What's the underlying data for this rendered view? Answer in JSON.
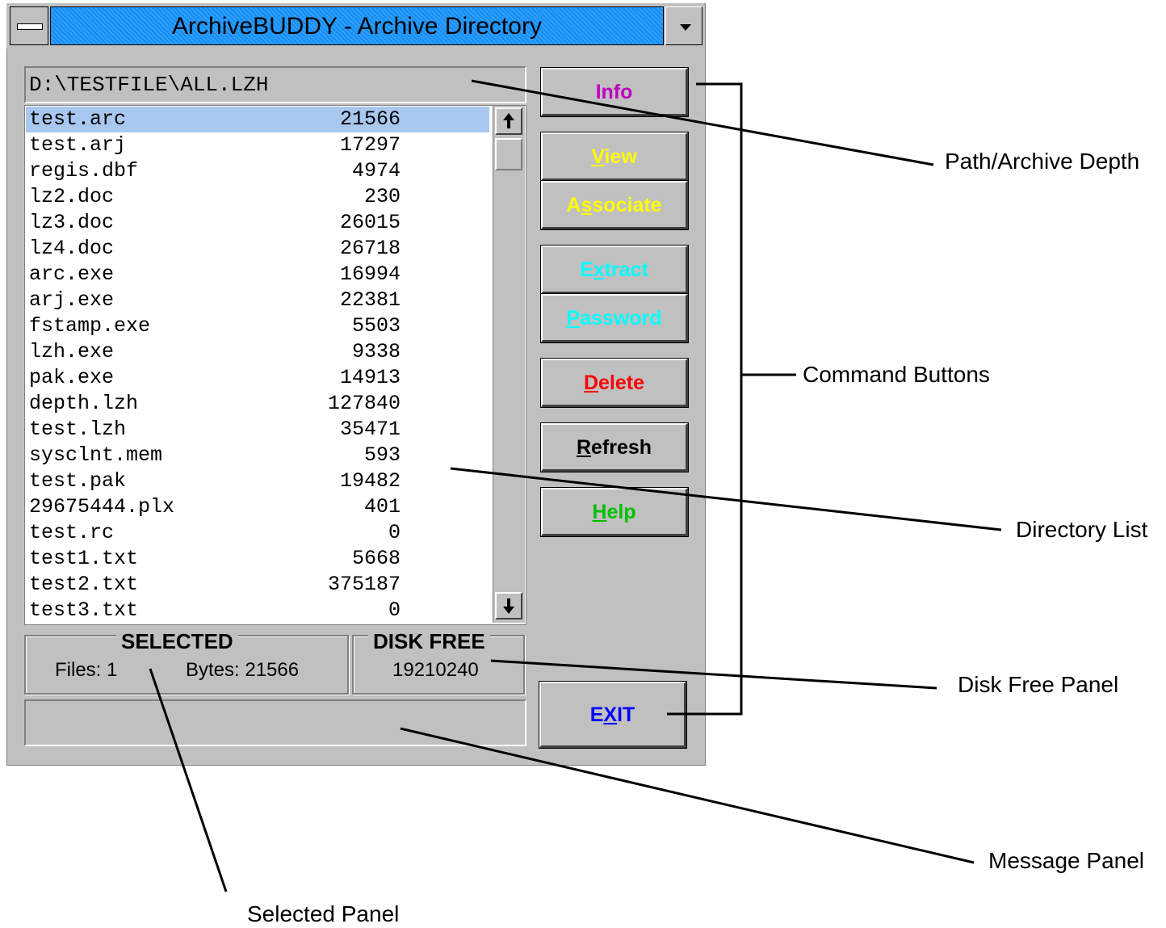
{
  "window": {
    "title": "ArchiveBUDDY - Archive Directory"
  },
  "path": "D:\\TESTFILE\\ALL.LZH",
  "files": [
    {
      "name": "test.arc",
      "size": "21566",
      "selected": true
    },
    {
      "name": "test.arj",
      "size": "17297"
    },
    {
      "name": "regis.dbf",
      "size": "4974"
    },
    {
      "name": "lz2.doc",
      "size": "230"
    },
    {
      "name": "lz3.doc",
      "size": "26015"
    },
    {
      "name": "lz4.doc",
      "size": "26718"
    },
    {
      "name": "arc.exe",
      "size": "16994"
    },
    {
      "name": "arj.exe",
      "size": "22381"
    },
    {
      "name": "fstamp.exe",
      "size": "5503"
    },
    {
      "name": "lzh.exe",
      "size": "9338"
    },
    {
      "name": "pak.exe",
      "size": "14913"
    },
    {
      "name": "depth.lzh",
      "size": "127840"
    },
    {
      "name": "test.lzh",
      "size": "35471"
    },
    {
      "name": "sysclnt.mem",
      "size": "593"
    },
    {
      "name": "test.pak",
      "size": "19482"
    },
    {
      "name": "29675444.plx",
      "size": "401"
    },
    {
      "name": "test.rc",
      "size": "0"
    },
    {
      "name": "test1.txt",
      "size": "5668"
    },
    {
      "name": "test2.txt",
      "size": "375187"
    },
    {
      "name": "test3.txt",
      "size": "0"
    }
  ],
  "buttons": {
    "info": {
      "label": "Info",
      "color": "#c000c0"
    },
    "view": {
      "pre": "",
      "ul": "V",
      "post": "iew",
      "color": "#ffff00"
    },
    "associate": {
      "pre": "A",
      "ul": "s",
      "post": "sociate",
      "color": "#ffff00"
    },
    "extract": {
      "pre": "E",
      "ul": "x",
      "post": "tract",
      "color": "#00ffff"
    },
    "password": {
      "pre": "",
      "ul": "P",
      "post": "assword",
      "color": "#00ffff"
    },
    "delete": {
      "pre": "",
      "ul": "D",
      "post": "elete",
      "color": "#ff0000"
    },
    "refresh": {
      "pre": "",
      "ul": "R",
      "post": "efresh",
      "color": "#000000"
    },
    "help": {
      "pre": "",
      "ul": "H",
      "post": "elp",
      "color": "#00c000"
    },
    "exit": {
      "pre": "E",
      "ul": "X",
      "post": "IT",
      "color": "#0000ff"
    }
  },
  "selected_panel": {
    "title": "SELECTED",
    "files_text": "Files: 1",
    "bytes_text": "Bytes: 21566"
  },
  "disk_free_panel": {
    "title": "DISK FREE",
    "value": "19210240"
  },
  "message_panel": {
    "text": ""
  },
  "callouts": {
    "path": "Path/Archive Depth",
    "commands": "Command Buttons",
    "directory": "Directory List",
    "disk_free": "Disk Free Panel",
    "message": "Message Panel",
    "selected": "Selected Panel"
  },
  "scroll": {
    "up_glyph": "🡑",
    "down_glyph": "🡓"
  }
}
